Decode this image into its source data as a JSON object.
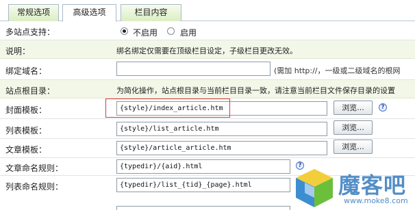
{
  "tabs": [
    {
      "label": "常规选项",
      "active": false
    },
    {
      "label": "高级选项",
      "active": true
    },
    {
      "label": "栏目内容",
      "active": false
    }
  ],
  "multi_site": {
    "label": "多站点支持：",
    "options": [
      {
        "label": "不启用",
        "selected": true
      },
      {
        "label": "启用",
        "selected": false
      }
    ]
  },
  "note": {
    "label": "说明：",
    "text": "绑名绑定仅需要在顶级栏目设定，子级栏目更改无效。"
  },
  "bind_domain": {
    "label": "绑定域名：",
    "value": "",
    "hint": "(需加 http://，一级或二级域名的根网"
  },
  "site_root": {
    "label": "站点根目录：",
    "text": "为简化操作，站点根目录与当前栏目目录一致，请注意当前栏目文件保存目录的设置"
  },
  "fields": [
    {
      "label": "封面模板：",
      "value": "{style}/index_article.htm",
      "button": "浏览...",
      "help": true
    },
    {
      "label": "列表模板：",
      "value": "{style}/list_article.htm",
      "button": "浏览...",
      "help": false
    },
    {
      "label": "文章模板：",
      "value": "{style}/article_article.htm",
      "button": "浏览...",
      "help": false
    },
    {
      "label": "文章命名规则：",
      "value": "{typedir}/{aid}.html",
      "help": true
    },
    {
      "label": "列表命名规则：",
      "value": "{typedir}/list_{tid}_{page}.html"
    }
  ],
  "watermark": {
    "text": "魔客吧",
    "url": "www.moke8.com"
  },
  "colors": {
    "tab_active": "#ffffff",
    "tab_inactive": "#dbeec4",
    "row_shade": "#f2f7e8",
    "highlight": "#d23c3c",
    "watermark": "#3c7fc0"
  }
}
